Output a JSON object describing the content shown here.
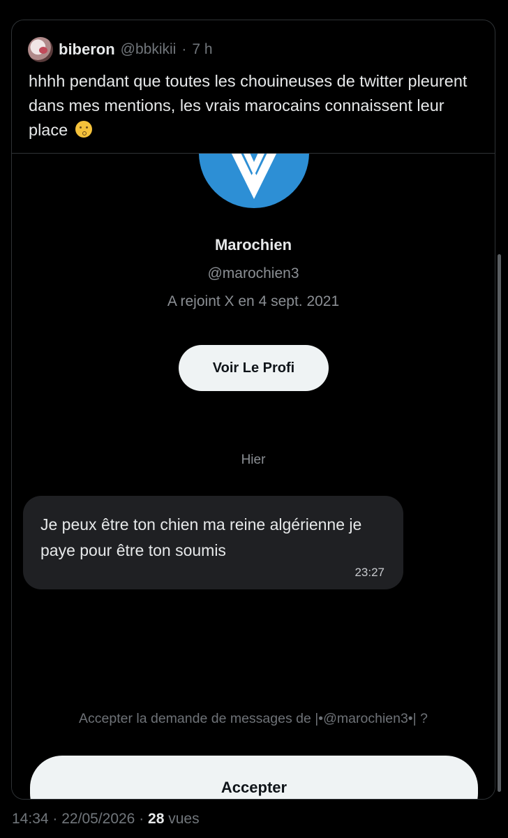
{
  "tweet": {
    "author_name": "biberon",
    "author_handle": "@bbkikii",
    "separator": "·",
    "time_ago": "7 h",
    "text": "hhhh pendant que toutes les chouineuses de twitter pleurent dans mes mentions, les vrais marocains connaissent leur place",
    "emoji": "kissing-face-emoji"
  },
  "embed": {
    "profile": {
      "name": "Marochien",
      "handle": "@marochien3",
      "joined": "A rejoint X en 4 sept. 2021",
      "button_label": "Voir Le Profi",
      "avatar_icon": "om-logo-icon"
    },
    "day_label": "Hier",
    "message": {
      "text": "Je peux être ton chien ma reine algérienne je paye pour être ton soumis",
      "time": "23:27"
    },
    "request_text": "Accepter la demande de messages de |•@marochien3•| ?",
    "accept_label": "Accepter"
  },
  "footer": {
    "time": "14:34",
    "sep1": "·",
    "date": "22/05/2026",
    "sep2": "·",
    "views_count": "28",
    "views_label": "vues"
  },
  "colors": {
    "background": "#000000",
    "text": "#e7e9ea",
    "muted": "#71767b",
    "bubble": "#1f2023",
    "button": "#eff3f4",
    "om_blue": "#2d8fd5"
  }
}
